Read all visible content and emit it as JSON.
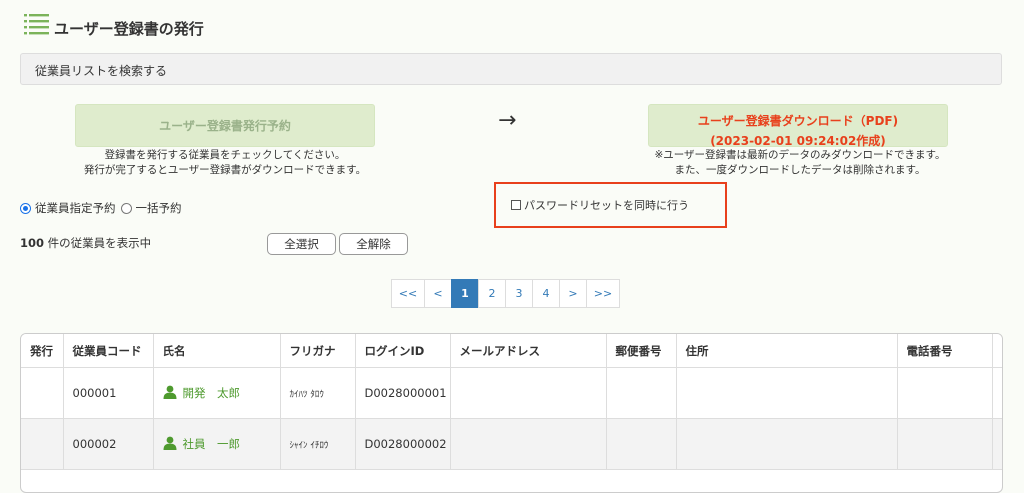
{
  "page": {
    "title": "ユーザー登録書の発行"
  },
  "search_bar": {
    "label": "従業員リストを検索する"
  },
  "actions": {
    "reserve_button": "ユーザー登録書発行予約",
    "arrow": "→",
    "download_button_line1": "ユーザー登録書ダウンロード（PDF)",
    "download_button_line2": "(2023-02-01 09:24:02作成)",
    "left_note_line1": "登録書を発行する従業員をチェックしてください。",
    "left_note_line2": "発行が完了するとユーザー登録書がダウンロードできます。",
    "right_note_line1": "※ユーザー登録書は最新のデータのみダウンロードできます。",
    "right_note_line2": "また、一度ダウンロードしたデータは削除されます。"
  },
  "reservation": {
    "option1": "従業員指定予約",
    "option2": "一括予約",
    "selected": "従業員指定予約"
  },
  "password_reset": {
    "label": "パスワードリセットを同時に行う",
    "checked": false
  },
  "count": {
    "number": "100",
    "suffix": " 件の従業員を表示中"
  },
  "selection": {
    "select_all": "全選択",
    "deselect_all": "全解除"
  },
  "pagination": {
    "first": "<<",
    "prev": "<",
    "pages": [
      "1",
      "2",
      "3",
      "4"
    ],
    "next": ">",
    "last": ">>",
    "current": "1"
  },
  "table": {
    "headers": [
      "発行",
      "従業員コード",
      "氏名",
      "フリガナ",
      "ログインID",
      "メールアドレス",
      "郵便番号",
      "住所",
      "電話番号",
      ""
    ],
    "rows": [
      {
        "code": "000001",
        "name": "開発　太郎",
        "kana": "ｶｲﾊﾂ ﾀﾛｳ",
        "login": "D0028000001"
      },
      {
        "code": "000002",
        "name": "社員　一郎",
        "kana": "ｼｬｲﾝ ｲﾁﾛｳ",
        "login": "D0028000002"
      }
    ]
  },
  "colors": {
    "accent": "#337ab7",
    "highlight": "#e8401c",
    "button_green": "#dfeccd",
    "name_green": "#4e9a2e"
  },
  "icons": {
    "title": "list-icon",
    "person": "person-icon"
  }
}
